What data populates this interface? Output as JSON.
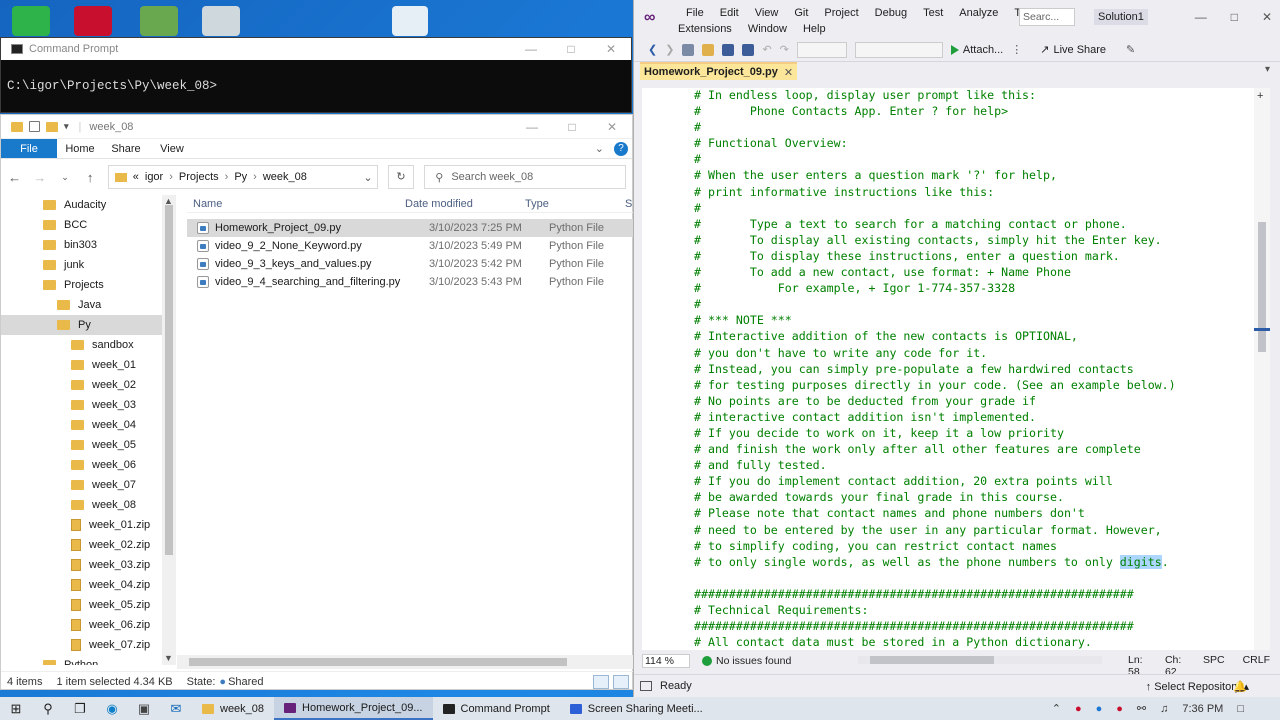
{
  "cmd": {
    "title": "Command Prompt",
    "prompt": "C:\\igor\\Projects\\Py\\week_08>"
  },
  "explorer": {
    "title": "week_08",
    "ribbon": {
      "file": "File",
      "home": "Home",
      "share": "Share",
      "view": "View",
      "help": "?"
    },
    "address": {
      "root": "«",
      "parts": [
        "igor",
        "Projects",
        "Py",
        "week_08"
      ]
    },
    "search_placeholder": "Search week_08",
    "tree": [
      {
        "label": "Audacity",
        "indent": 1,
        "kind": "folder"
      },
      {
        "label": "BCC",
        "indent": 1,
        "kind": "folder"
      },
      {
        "label": "bin303",
        "indent": 1,
        "kind": "folder"
      },
      {
        "label": "junk",
        "indent": 1,
        "kind": "folder"
      },
      {
        "label": "Projects",
        "indent": 1,
        "kind": "folder"
      },
      {
        "label": "Java",
        "indent": 2,
        "kind": "folder"
      },
      {
        "label": "Py",
        "indent": 2,
        "kind": "folder",
        "selected": true
      },
      {
        "label": "sandbox",
        "indent": 3,
        "kind": "folder"
      },
      {
        "label": "week_01",
        "indent": 3,
        "kind": "folder"
      },
      {
        "label": "week_02",
        "indent": 3,
        "kind": "folder"
      },
      {
        "label": "week_03",
        "indent": 3,
        "kind": "folder"
      },
      {
        "label": "week_04",
        "indent": 3,
        "kind": "folder"
      },
      {
        "label": "week_05",
        "indent": 3,
        "kind": "folder"
      },
      {
        "label": "week_06",
        "indent": 3,
        "kind": "folder"
      },
      {
        "label": "week_07",
        "indent": 3,
        "kind": "folder"
      },
      {
        "label": "week_08",
        "indent": 3,
        "kind": "folder"
      },
      {
        "label": "week_01.zip",
        "indent": 3,
        "kind": "zip"
      },
      {
        "label": "week_02.zip",
        "indent": 3,
        "kind": "zip"
      },
      {
        "label": "week_03.zip",
        "indent": 3,
        "kind": "zip"
      },
      {
        "label": "week_04.zip",
        "indent": 3,
        "kind": "zip"
      },
      {
        "label": "week_05.zip",
        "indent": 3,
        "kind": "zip"
      },
      {
        "label": "week_06.zip",
        "indent": 3,
        "kind": "zip"
      },
      {
        "label": "week_07.zip",
        "indent": 3,
        "kind": "zip"
      },
      {
        "label": "Python",
        "indent": 1,
        "kind": "folder"
      }
    ],
    "columns": {
      "name": "Name",
      "date": "Date modified",
      "type": "Type",
      "size": "S"
    },
    "files": [
      {
        "name": "Homework_Project_09.py",
        "date": "3/10/2023 7:25 PM",
        "type": "Python File",
        "selected": true
      },
      {
        "name": "video_9_2_None_Keyword.py",
        "date": "3/10/2023 5:49 PM",
        "type": "Python File"
      },
      {
        "name": "video_9_3_keys_and_values.py",
        "date": "3/10/2023 5:42 PM",
        "type": "Python File"
      },
      {
        "name": "video_9_4_searching_and_filtering.py",
        "date": "3/10/2023 5:43 PM",
        "type": "Python File"
      }
    ],
    "status": {
      "items": "4 items",
      "selected": "1 item selected  4.34 KB",
      "state": "State:",
      "shared": "Shared"
    }
  },
  "vs": {
    "menu1": [
      "File",
      "Edit",
      "View",
      "Git",
      "Project",
      "Debug",
      "Test",
      "Analyze",
      "Tools"
    ],
    "menu2": [
      "Extensions",
      "Window",
      "Help"
    ],
    "search": "Searc...",
    "solution": "Solution1",
    "attach": "Attach...",
    "live_share": "Live Share",
    "tab": "Homework_Project_09.py",
    "code_lines": [
      "# In endless loop, display user prompt like this:",
      "#       Phone Contacts App. Enter ? for help>",
      "#",
      "# Functional Overview:",
      "#",
      "# When the user enters a question mark '?' for help,",
      "# print informative instructions like this:",
      "#",
      "#       Type a text to search for a matching contact or phone.",
      "#       To display all existing contacts, simply hit the Enter key.",
      "#       To display these instructions, enter a question mark.",
      "#       To add a new contact, use format: + Name Phone",
      "#           For example, + Igor 1-774-357-3328",
      "#",
      "# *** NOTE ***",
      "# Interactive addition of the new contacts is OPTIONAL,",
      "# you don't have to write any code for it.",
      "# Instead, you can simply pre-populate a few hardwired contacts",
      "# for testing purposes directly in your code. (See an example below.)",
      "# No points are to be deducted from your grade if",
      "# interactive contact addition isn't implemented.",
      "# If you decide to work on it, keep it a low priority",
      "# and finish the work only after all other features are complete",
      "# and fully tested.",
      "# If you do implement contact addition, 20 extra points will",
      "# be awarded towards your final grade in this course.",
      "# Please note that contact names and phone numbers don't",
      "# need to be entered by the user in any particular format. However,",
      "# to simplify coding, you can restrict contact names",
      "# to only single words, as well as the phone numbers to only ",
      "",
      "###############################################################",
      "# Technical Requirements:",
      "###############################################################",
      "# All contact data must be stored in a Python dictionary."
    ],
    "highlighted_word": "digits",
    "after_highlight": ".",
    "zoom": "114 %",
    "issues": "No issues found",
    "ln": "Ln: 58",
    "ch": "Ch: 62",
    "spc": "SPC",
    "crlf": "CRLF",
    "status_ready": "Ready",
    "select_repo": "Select Repository"
  },
  "taskbar": {
    "apps": [
      {
        "label": "week_08",
        "color": "#e9b949"
      },
      {
        "label": "Homework_Project_09...",
        "color": "#68217a",
        "active": true
      },
      {
        "label": "Command Prompt",
        "color": "#222222"
      },
      {
        "label": "Screen Sharing Meeti...",
        "color": "#2d5fd6"
      }
    ],
    "time": "7:36 PM"
  }
}
